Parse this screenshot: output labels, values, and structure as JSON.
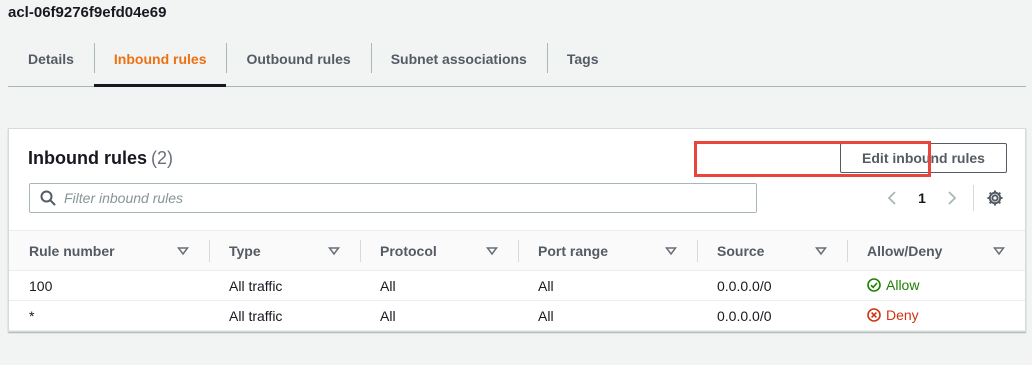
{
  "acl_id": "acl-06f9276f9efd04e69",
  "tabs": [
    {
      "label": "Details",
      "active": false
    },
    {
      "label": "Inbound rules",
      "active": true
    },
    {
      "label": "Outbound rules",
      "active": false
    },
    {
      "label": "Subnet associations",
      "active": false
    },
    {
      "label": "Tags",
      "active": false
    }
  ],
  "panel": {
    "title": "Inbound rules",
    "count": "(2)",
    "edit_button_label": "Edit inbound rules",
    "filter_placeholder": "Filter inbound rules",
    "filter_value": "",
    "page": "1"
  },
  "table": {
    "columns": [
      "Rule number",
      "Type",
      "Protocol",
      "Port range",
      "Source",
      "Allow/Deny"
    ],
    "rows": [
      {
        "rule_number": "100",
        "type": "All traffic",
        "protocol": "All",
        "port_range": "All",
        "source": "0.0.0.0/0",
        "action": "Allow"
      },
      {
        "rule_number": "*",
        "type": "All traffic",
        "protocol": "All",
        "port_range": "All",
        "source": "0.0.0.0/0",
        "action": "Deny"
      }
    ]
  },
  "colors": {
    "active_tab": "#ec7211",
    "allow": "#1d8102",
    "deny": "#d13212",
    "highlight_box": "#e8453c"
  },
  "icons": {
    "search": "search-icon",
    "prev": "chevron-left-icon",
    "next": "chevron-right-icon",
    "settings": "gear-icon",
    "sort": "caret-down-icon",
    "allow": "check-circle-icon",
    "deny": "x-circle-icon"
  }
}
